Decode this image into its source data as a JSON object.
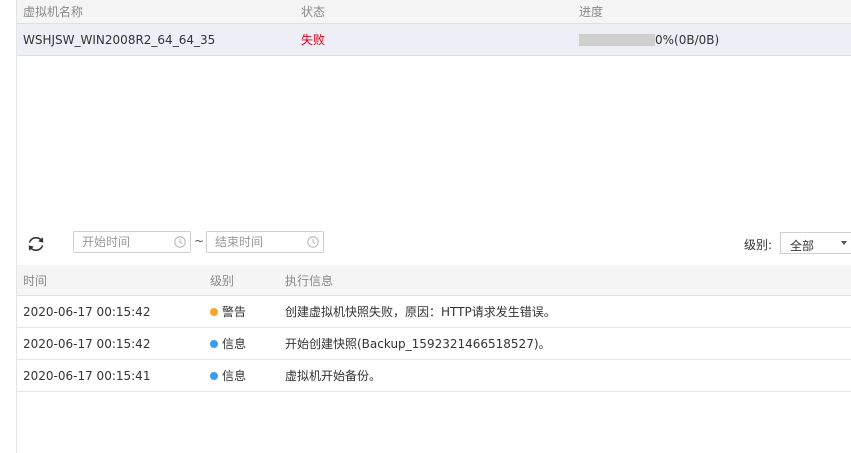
{
  "vm_table": {
    "headers": [
      "虚拟机名称",
      "状态",
      "进度"
    ],
    "rows": [
      {
        "name": "WSHJSW_WIN2008R2_64_64_35",
        "status": "失败",
        "status_color": "#d0021b",
        "progress": 0,
        "progress_text": "0%(0B/0B)"
      }
    ]
  },
  "toolbar": {
    "start_placeholder": "开始时间",
    "separator": "~",
    "end_placeholder": "结束时间",
    "level_label": "级别:",
    "level_selected": "全部"
  },
  "log_table": {
    "headers": [
      "时间",
      "级别",
      "执行信息"
    ],
    "rows": [
      {
        "time": "2020-06-17 00:15:42",
        "level": "警告",
        "level_color": "#f5a623",
        "message": "创建虚拟机快照失败，原因：HTTP请求发生错误。"
      },
      {
        "time": "2020-06-17 00:15:42",
        "level": "信息",
        "level_color": "#3a9bf0",
        "message": "开始创建快照(Backup_1592321466518527)。"
      },
      {
        "time": "2020-06-17 00:15:41",
        "level": "信息",
        "level_color": "#3a9bf0",
        "message": "虚拟机开始备份。"
      }
    ]
  },
  "icons": {
    "refresh": "refresh-icon",
    "clock": "clock-icon",
    "dropdown": "chevron-down-icon"
  }
}
